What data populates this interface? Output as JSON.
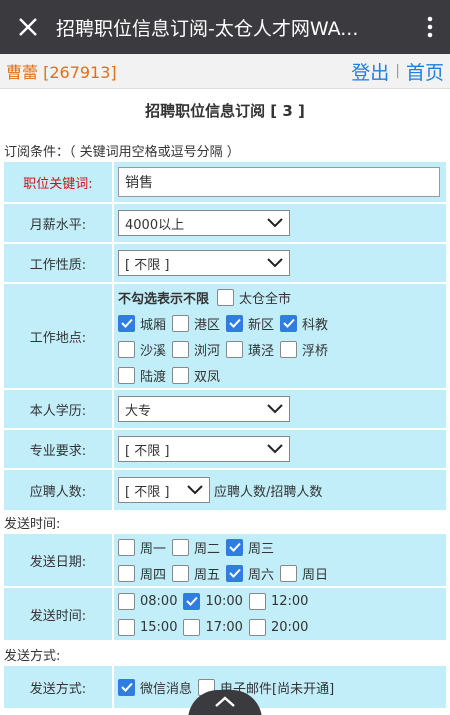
{
  "titlebar": {
    "title": "招聘职位信息订阅-太仓人才网WA...",
    "close_icon": "close-icon",
    "more_icon": "more-vertical-icon"
  },
  "userbar": {
    "user": "曹蕾 [267913]",
    "logout": "登出",
    "separator": "|",
    "home": "首页"
  },
  "heading": "招聘职位信息订阅 [ 3 ]",
  "subscribe_note": "订阅条件：（ 关键词用空格或逗号分隔 ）",
  "keyword": {
    "label": "职位关键词:",
    "value": "销售"
  },
  "salary": {
    "label": "月薪水平:",
    "value": "4000以上"
  },
  "job_type": {
    "label": "工作性质:",
    "value": "[ 不限 ]"
  },
  "location": {
    "label": "工作地点:",
    "hint": "不勾选表示不限",
    "all": {
      "label": "太仓全市",
      "checked": false
    },
    "options": [
      {
        "label": "城厢",
        "checked": true
      },
      {
        "label": "港区",
        "checked": false
      },
      {
        "label": "新区",
        "checked": true
      },
      {
        "label": "科教",
        "checked": true
      },
      {
        "label": "沙溪",
        "checked": false
      },
      {
        "label": "浏河",
        "checked": false
      },
      {
        "label": "璜泾",
        "checked": false
      },
      {
        "label": "浮桥",
        "checked": false
      },
      {
        "label": "陆渡",
        "checked": false
      },
      {
        "label": "双凤",
        "checked": false
      }
    ]
  },
  "education": {
    "label": "本人学历:",
    "value": "大专"
  },
  "major": {
    "label": "专业要求:",
    "value": "[ 不限 ]"
  },
  "applicants": {
    "label": "应聘人数:",
    "value": "[ 不限 ]",
    "suffix": "应聘人数/招聘人数"
  },
  "send_time_section": "发送时间:",
  "send_days": {
    "label": "发送日期:",
    "options": [
      {
        "label": "周一",
        "checked": false
      },
      {
        "label": "周二",
        "checked": false
      },
      {
        "label": "周三",
        "checked": true
      },
      {
        "label": "周四",
        "checked": false
      },
      {
        "label": "周五",
        "checked": false
      },
      {
        "label": "周六",
        "checked": true
      },
      {
        "label": "周日",
        "checked": false
      }
    ]
  },
  "send_hours": {
    "label": "发送时间:",
    "options": [
      {
        "label": "08:00",
        "checked": false
      },
      {
        "label": "10:00",
        "checked": true
      },
      {
        "label": "12:00",
        "checked": false
      },
      {
        "label": "15:00",
        "checked": false
      },
      {
        "label": "17:00",
        "checked": false
      },
      {
        "label": "20:00",
        "checked": false
      }
    ]
  },
  "send_method_section": "发送方式:",
  "send_method": {
    "label": "发送方式:",
    "options": [
      {
        "label": "微信消息",
        "checked": true
      },
      {
        "label": "电子邮件[尚未开通]",
        "checked": false
      }
    ]
  },
  "colors": {
    "title_bg": "#3a3a3f",
    "row_bg": "#c2eefa",
    "accent": "#2f7de1",
    "user": "#e0701a",
    "link": "#1d7fe0",
    "required": "#d01010"
  }
}
